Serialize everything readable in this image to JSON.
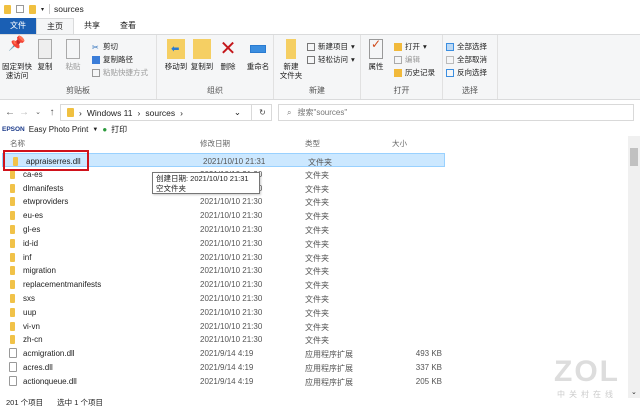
{
  "title": "sources",
  "tabs": [
    "文件",
    "主页",
    "共享",
    "查看"
  ],
  "ribbon": {
    "clipboard": {
      "label": "剪贴板",
      "pin": "固定到快\n速访问",
      "copy": "复制",
      "paste": "粘贴",
      "cut": "剪切",
      "copy_path": "复制路径",
      "paste_shortcut": "粘贴快捷方式"
    },
    "organize": {
      "label": "组织",
      "move_to": "移动到",
      "copy_to": "复制到",
      "delete": "删除",
      "rename": "重命名"
    },
    "new": {
      "label": "新建",
      "new_folder": "新建\n文件夹",
      "new_item": "新建项目",
      "easy_access": "轻松访问"
    },
    "open": {
      "label": "打开",
      "properties": "属性",
      "open": "打开",
      "edit": "编辑",
      "history": "历史记录"
    },
    "select": {
      "label": "选择",
      "select_all": "全部选择",
      "select_none": "全部取消",
      "invert": "反向选择"
    }
  },
  "address": {
    "crumbs": [
      "Windows 11",
      "sources"
    ],
    "search_placeholder": "搜索\"sources\""
  },
  "epson": {
    "brand": "EPSON",
    "app": "Easy Photo Print",
    "print": "打印"
  },
  "columns": [
    "名称",
    "修改日期",
    "类型",
    "大小"
  ],
  "rows": [
    {
      "name": "appraiserres.dll",
      "date": "2021/10/10 21:31",
      "type": "文件夹",
      "size": "",
      "kind": "folder"
    },
    {
      "name": "ca-es",
      "date": "2021/10/10 21:30",
      "type": "文件夹",
      "size": "",
      "kind": "folder"
    },
    {
      "name": "dlmanifests",
      "date": "2021/10/10 21:30",
      "type": "文件夹",
      "size": "",
      "kind": "folder"
    },
    {
      "name": "etwproviders",
      "date": "2021/10/10 21:30",
      "type": "文件夹",
      "size": "",
      "kind": "folder"
    },
    {
      "name": "eu-es",
      "date": "2021/10/10 21:30",
      "type": "文件夹",
      "size": "",
      "kind": "folder"
    },
    {
      "name": "gl-es",
      "date": "2021/10/10 21:30",
      "type": "文件夹",
      "size": "",
      "kind": "folder"
    },
    {
      "name": "id-id",
      "date": "2021/10/10 21:30",
      "type": "文件夹",
      "size": "",
      "kind": "folder"
    },
    {
      "name": "inf",
      "date": "2021/10/10 21:30",
      "type": "文件夹",
      "size": "",
      "kind": "folder"
    },
    {
      "name": "migration",
      "date": "2021/10/10 21:30",
      "type": "文件夹",
      "size": "",
      "kind": "folder"
    },
    {
      "name": "replacementmanifests",
      "date": "2021/10/10 21:30",
      "type": "文件夹",
      "size": "",
      "kind": "folder"
    },
    {
      "name": "sxs",
      "date": "2021/10/10 21:30",
      "type": "文件夹",
      "size": "",
      "kind": "folder"
    },
    {
      "name": "uup",
      "date": "2021/10/10 21:30",
      "type": "文件夹",
      "size": "",
      "kind": "folder"
    },
    {
      "name": "vi-vn",
      "date": "2021/10/10 21:30",
      "type": "文件夹",
      "size": "",
      "kind": "folder"
    },
    {
      "name": "zh-cn",
      "date": "2021/10/10 21:30",
      "type": "文件夹",
      "size": "",
      "kind": "folder"
    },
    {
      "name": "acmigration.dll",
      "date": "2021/9/14 4:19",
      "type": "应用程序扩展",
      "size": "493 KB",
      "kind": "dll"
    },
    {
      "name": "acres.dll",
      "date": "2021/9/14 4:19",
      "type": "应用程序扩展",
      "size": "337 KB",
      "kind": "dll"
    },
    {
      "name": "actionqueue.dll",
      "date": "2021/9/14 4:19",
      "type": "应用程序扩展",
      "size": "205 KB",
      "kind": "dll"
    }
  ],
  "tooltip": {
    "line1": "创建日期: 2021/10/10 21:31",
    "line2": "空文件夹"
  },
  "status": {
    "count": "201 个项目",
    "selected": "选中 1 个项目"
  },
  "watermark": {
    "logo": "ZOL",
    "sub": "中关村在线"
  }
}
